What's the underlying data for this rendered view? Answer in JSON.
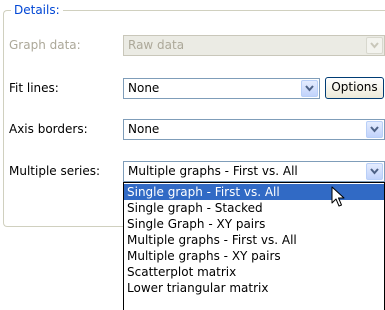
{
  "details": {
    "title": "Details:",
    "graph_data": {
      "label": "Graph data:",
      "value": "Raw data",
      "enabled": false
    },
    "fit_lines": {
      "label": "Fit lines:",
      "value": "None",
      "options_button": "Options"
    },
    "axis_borders": {
      "label": "Axis borders:",
      "value": "None"
    },
    "multiple_series": {
      "label": "Multiple series:",
      "value": "Multiple graphs - First vs. All",
      "dropdown_open": true,
      "options": [
        "Single graph - First vs. All",
        "Single graph - Stacked",
        "Single Graph - XY pairs",
        "Multiple graphs - First vs. All",
        "Multiple graphs - XY pairs",
        "Scatterplot matrix",
        "Lower triangular matrix"
      ],
      "highlighted_option": "Single graph - First vs. All"
    }
  },
  "icons": {
    "dropdown_arrow": "chevron-down-icon",
    "pointer": "arrow-pointer-icon"
  },
  "colors": {
    "group_title": "#0046d5",
    "combo_border": "#7f9db9",
    "disabled_text": "#aca899",
    "highlight": "#316ac5",
    "arrow": "#4d6185"
  }
}
